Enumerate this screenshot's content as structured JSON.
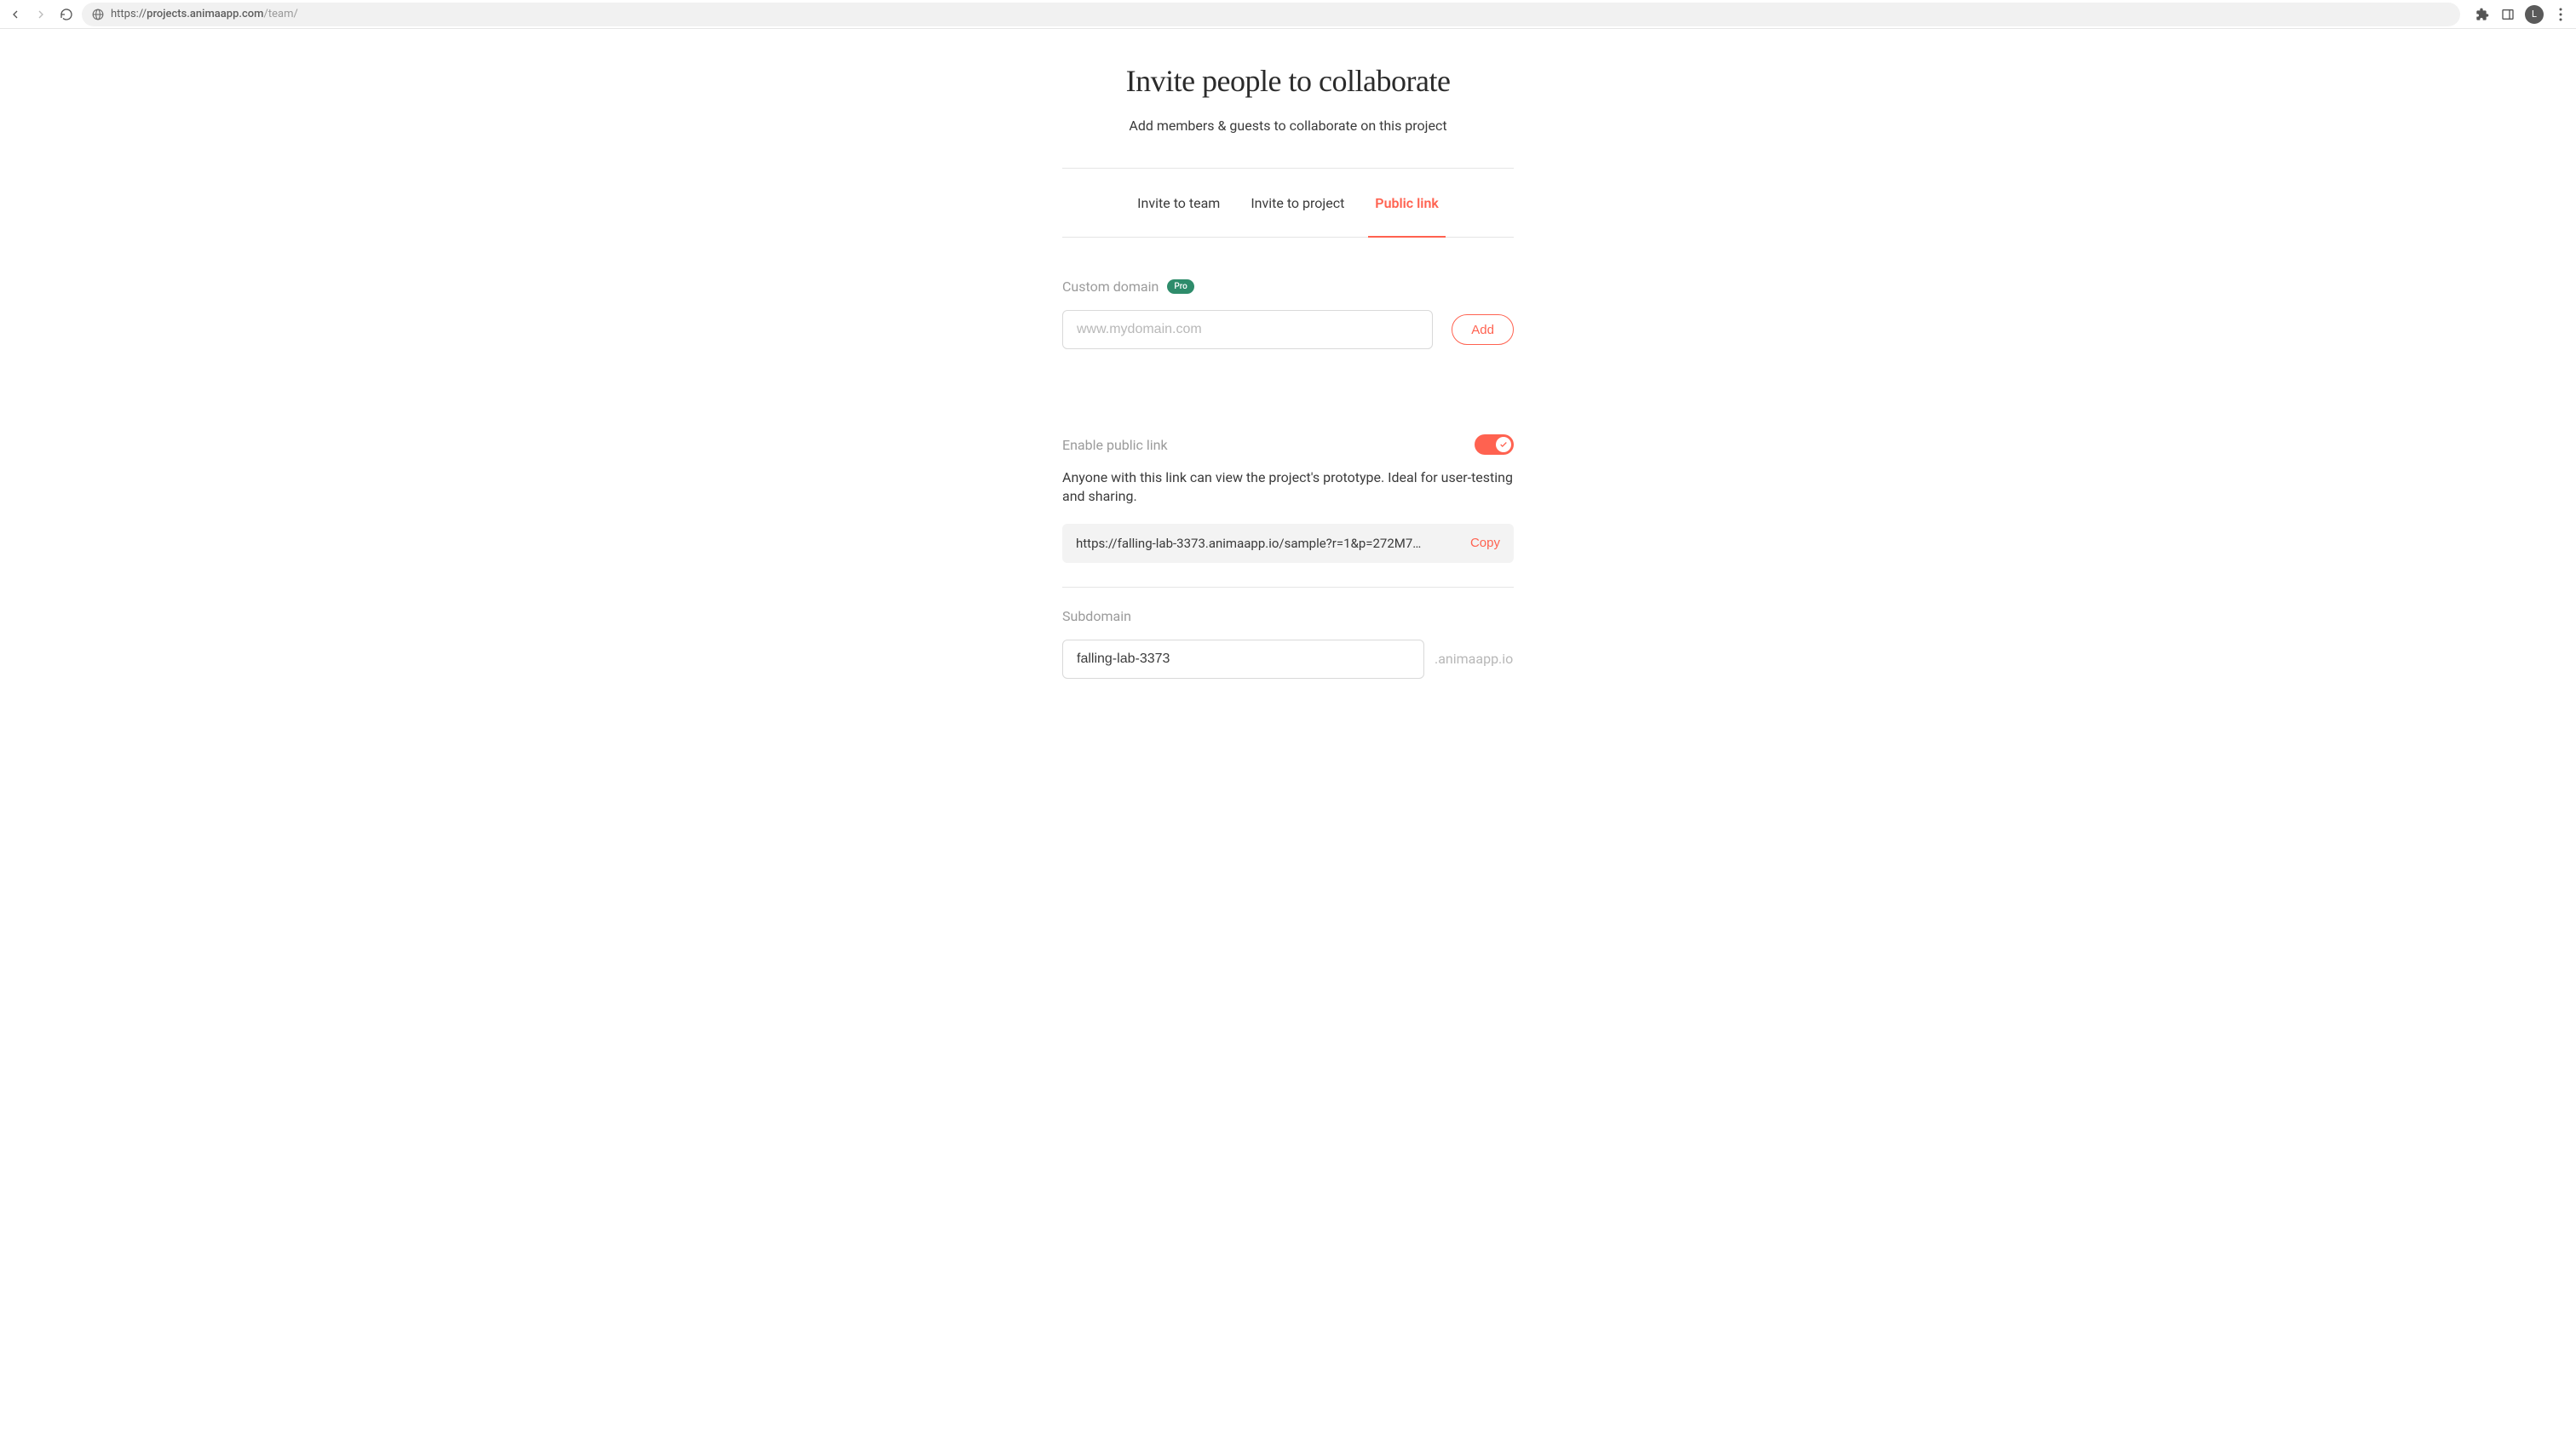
{
  "browser": {
    "url_host": "projects.animaapp.com",
    "url_path": "/team/",
    "avatar_initial": "L"
  },
  "header": {
    "title": "Invite people to collaborate",
    "subtitle": "Add members & guests to collaborate on this project"
  },
  "tabs": [
    {
      "label": "Invite to team"
    },
    {
      "label": "Invite to project"
    },
    {
      "label": "Public link"
    }
  ],
  "custom_domain": {
    "label": "Custom domain",
    "badge": "Pro",
    "placeholder": "www.mydomain.com",
    "add_label": "Add"
  },
  "public_link": {
    "toggle_label": "Enable public link",
    "description": "Anyone with this link can view the project's prototype. Ideal for user-testing and sharing.",
    "url": "https://falling-lab-3373.animaapp.io/sample?r=1&p=272M7…",
    "copy_label": "Copy"
  },
  "subdomain": {
    "label": "Subdomain",
    "value": "falling-lab-3373",
    "suffix": ".animaapp.io"
  }
}
